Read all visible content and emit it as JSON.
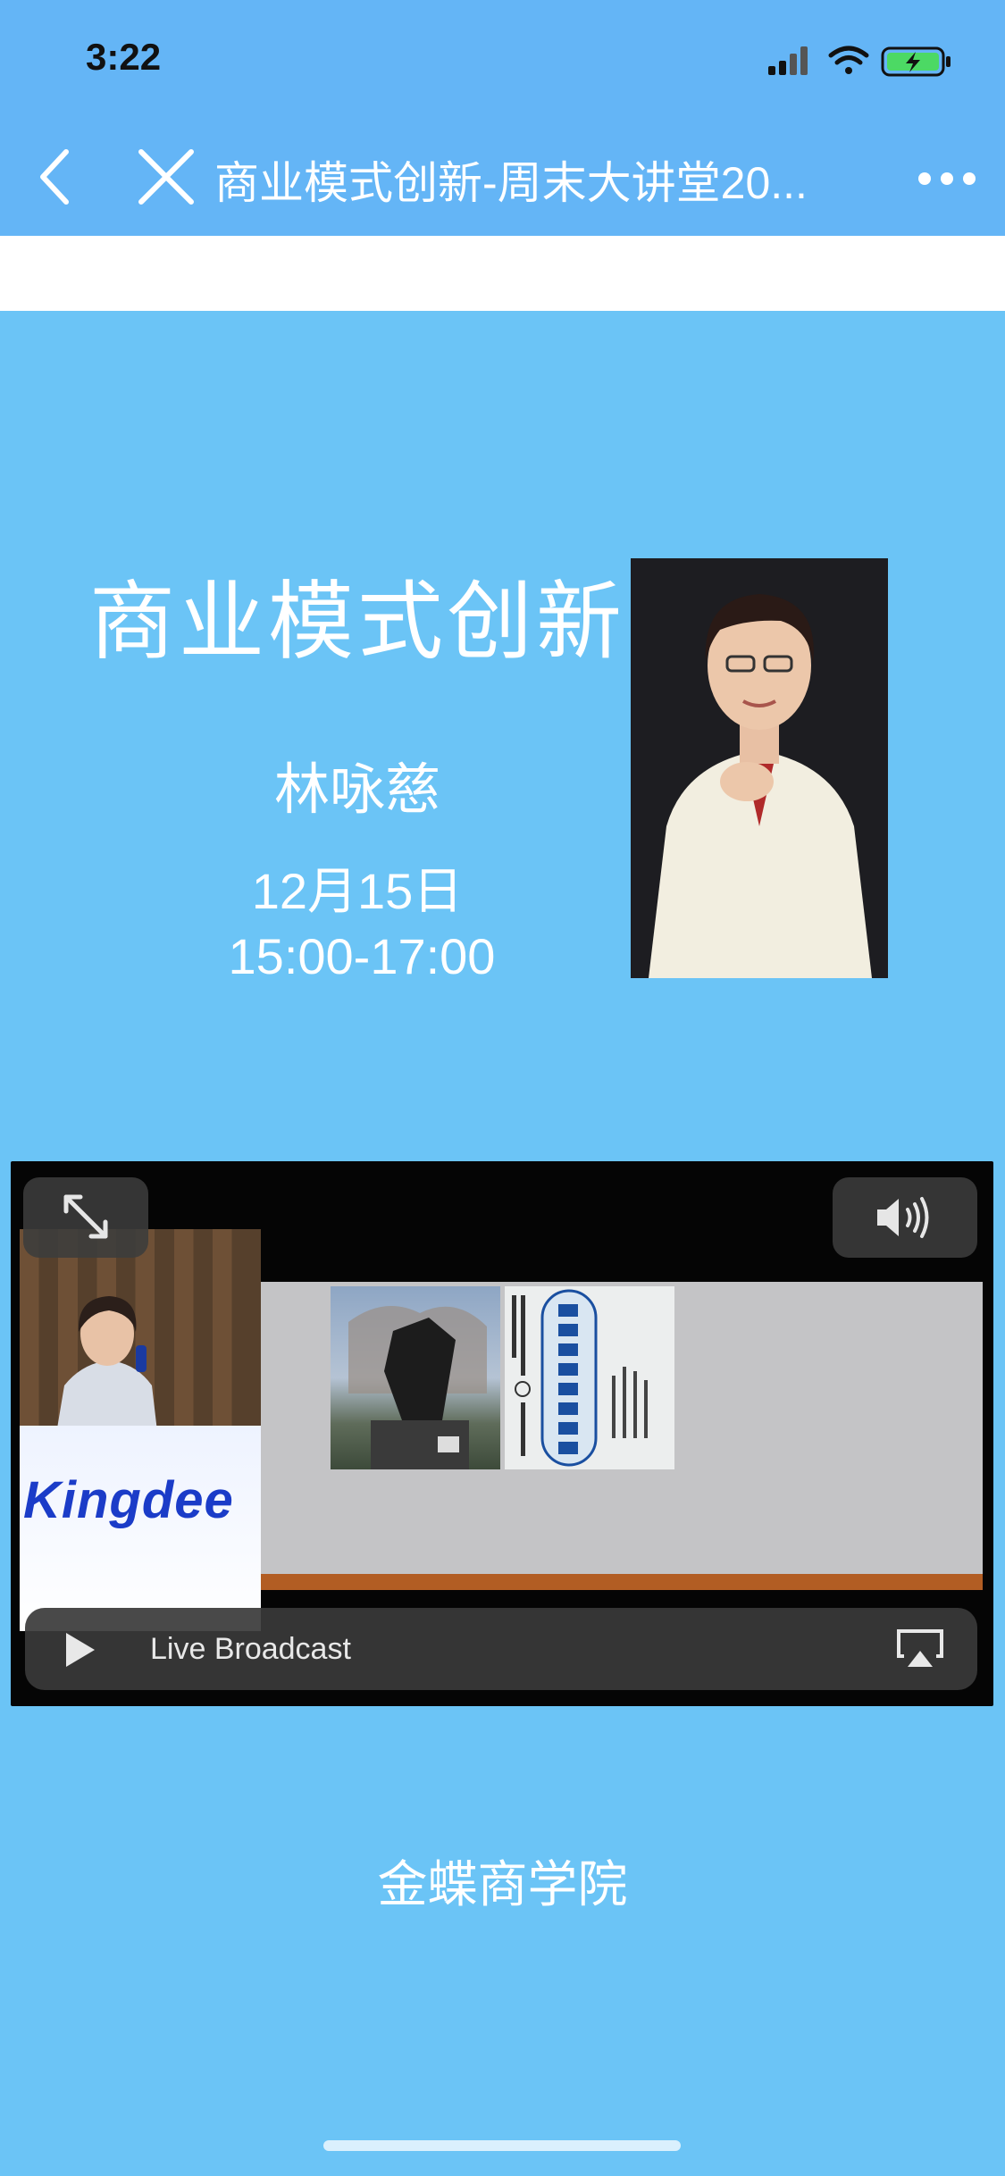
{
  "status_bar": {
    "time": "3:22"
  },
  "nav": {
    "title": "商业模式创新-周末大讲堂20..."
  },
  "poster": {
    "title": "商业模式创新",
    "speaker": "林咏慈",
    "date": "12月15日",
    "time": "15:00-17:00"
  },
  "player": {
    "inset_logo": "Kingdee",
    "live_label": "Live Broadcast"
  },
  "footer": {
    "org": "金蝶商学院"
  },
  "colors": {
    "nav_bg": "#64b5f6",
    "page_bg": "#6bc4f6",
    "logo_blue": "#1b3cc8"
  }
}
